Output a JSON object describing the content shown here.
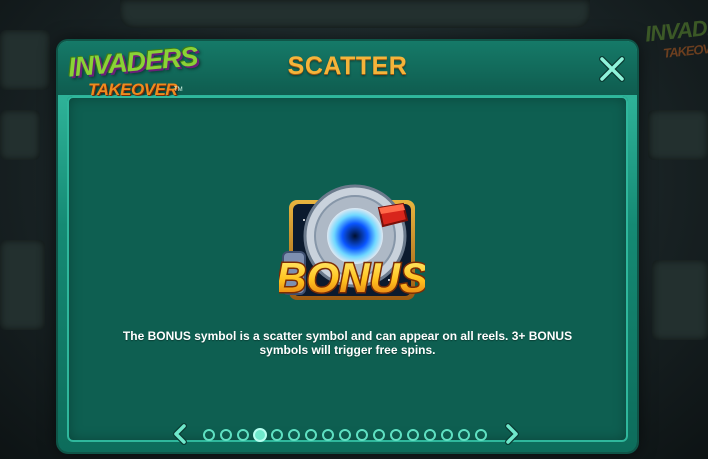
{
  "background": {
    "logo_line1": "INVADERS",
    "logo_line2": "TAKEOVER"
  },
  "modal": {
    "logo": {
      "line1": "INVADERS",
      "line2": "TAKEOVER",
      "tm": "TM"
    },
    "title": "SCATTER",
    "close_icon": "close-x-icon",
    "symbol": {
      "name": "bonus-symbol",
      "label": "BONUS"
    },
    "description": "The BONUS symbol is a scatter symbol and can appear on all reels. 3+ BONUS symbols will trigger free spins.",
    "pagination": {
      "total_pages": 17,
      "current_page": 4,
      "prev_icon": "chevron-left-icon",
      "next_icon": "chevron-right-icon"
    }
  },
  "colors": {
    "title": "#f5b43a",
    "frame": "#39c4a8",
    "panel": "#0e5f51",
    "dot": "#5fe0c2"
  }
}
